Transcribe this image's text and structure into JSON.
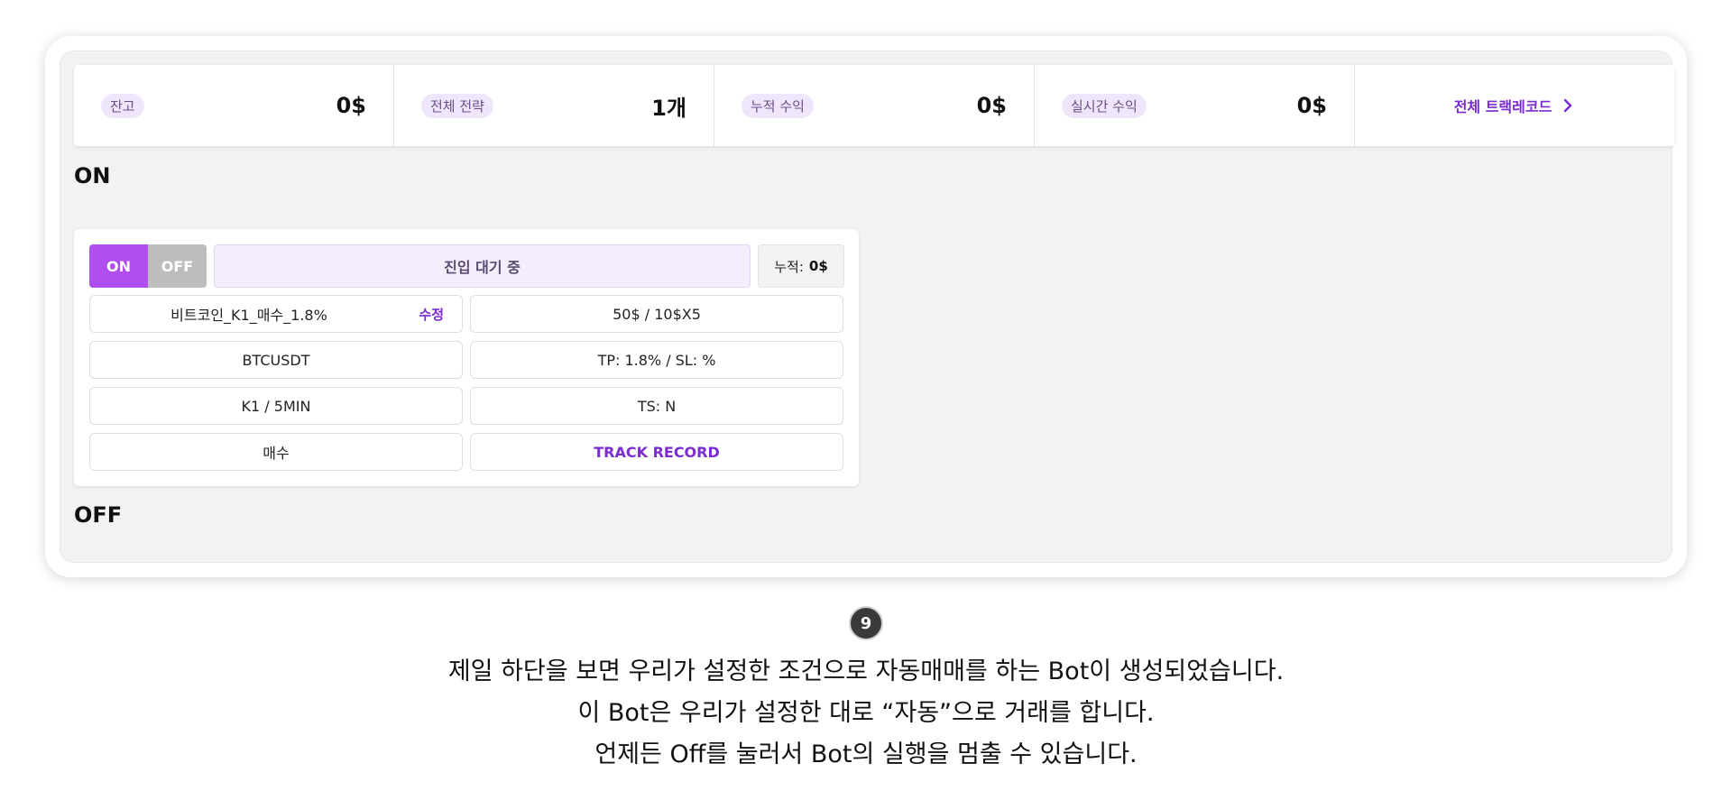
{
  "summary": {
    "balance": {
      "label": "잔고",
      "value": "0$"
    },
    "strategies": {
      "label": "전체 전략",
      "value": "1개"
    },
    "cumulative": {
      "label": "누적 수익",
      "value": "0$"
    },
    "realtime": {
      "label": "실시간 수익",
      "value": "0$"
    },
    "track_record_link": "전체 트랙레코드"
  },
  "sections": {
    "on": "ON",
    "off": "OFF"
  },
  "bot": {
    "toggle_on": "ON",
    "toggle_off": "OFF",
    "status": "진입 대기 중",
    "accum_label": "누적:",
    "accum_value": "0$",
    "name": "비트코인_K1_매수_1.8%",
    "edit": "수정",
    "amount": "50$ / 10$X5",
    "symbol": "BTCUSDT",
    "tp_sl": "TP: 1.8% / SL: %",
    "timeframe": "K1 / 5MIN",
    "ts": "TS: N",
    "side": "매수",
    "track_record": "TRACK RECORD"
  },
  "caption": {
    "step": "9",
    "line1": "제일 하단을 보면 우리가 설정한 조건으로 자동매매를 하는 Bot이 생성되었습니다.",
    "line2": "이 Bot은 우리가 설정한 대로 “자동”으로 거래를 합니다.",
    "line3": "언제든 Off를 눌러서 Bot의 실행을 멈출 수 있습니다."
  },
  "colors": {
    "accent": "#7a2bd1",
    "toggle_on": "#b04ef0",
    "toggle_off": "#bdbdbd"
  }
}
